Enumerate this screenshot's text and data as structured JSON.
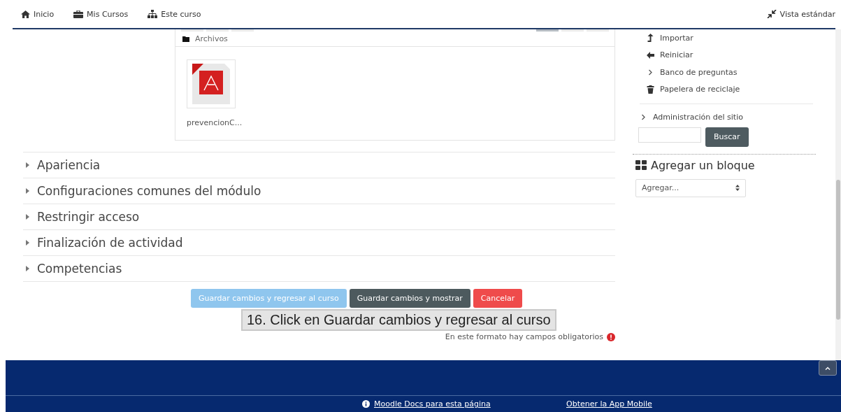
{
  "navbar": {
    "items": [
      {
        "label": "Inicio",
        "kind": "home"
      },
      {
        "label": "Mis Cursos",
        "kind": "briefcase"
      },
      {
        "label": "Este curso",
        "kind": "sitemap"
      }
    ],
    "right": "Vista estándar"
  },
  "filemanager": {
    "path": "Archivos",
    "files": [
      {
        "name": "prevencionC..."
      }
    ]
  },
  "sections": [
    {
      "label": "Apariencia",
      "expanded": false
    },
    {
      "label": "Configuraciones comunes del módulo",
      "expanded": false
    },
    {
      "label": "Restringir acceso",
      "expanded": false
    },
    {
      "label": "Finalización de actividad",
      "expanded": false
    },
    {
      "label": "Competencias",
      "expanded": false
    }
  ],
  "buttons": [
    {
      "label": "Guardar cambios y regresar al curso",
      "kind": "primary"
    },
    {
      "label": "Guardar cambios y mostrar",
      "kind": "secondary"
    },
    {
      "label": "Cancelar",
      "kind": "danger"
    }
  ],
  "required_note": "En este formato hay campos obligatorios",
  "caption": "16. Click en Guardar cambios y regresar al curso",
  "admin_menu": [
    {
      "label": "Importar",
      "kind": "upload"
    },
    {
      "label": "Reiniciar",
      "kind": "arrow"
    },
    {
      "label": "Banco de preguntas",
      "kind": "chevron"
    },
    {
      "label": "Papelera de reciclaje",
      "kind": "trash"
    }
  ],
  "site_admin": "Administración del sitio",
  "search_button": "Buscar",
  "add_block": {
    "title": "Agregar un bloque",
    "select": "Agregar..."
  },
  "footer": {
    "links": [
      "Moodle Docs para esta página",
      "Obtener la App Mobile"
    ]
  }
}
